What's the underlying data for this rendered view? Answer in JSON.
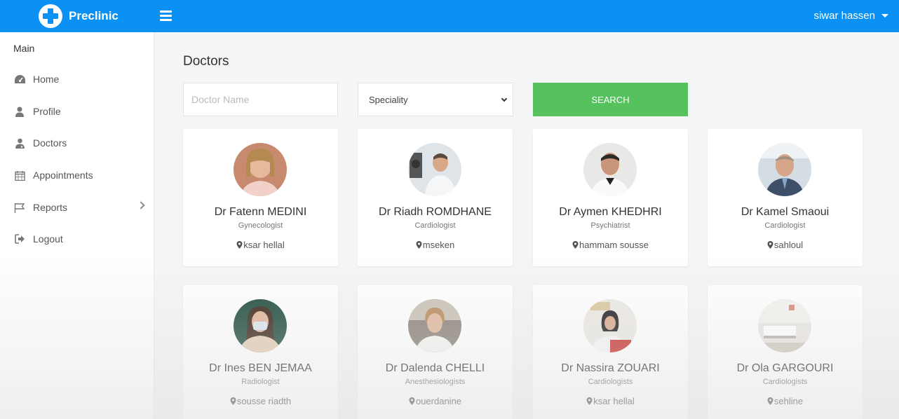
{
  "topbar": {
    "brand": "Preclinic",
    "user_name": "siwar hassen"
  },
  "sidebar": {
    "section_title": "Main",
    "items": [
      {
        "label": "Home",
        "icon": "dashboard-icon"
      },
      {
        "label": "Profile",
        "icon": "user-icon"
      },
      {
        "label": "Doctors",
        "icon": "doctor-icon"
      },
      {
        "label": "Appointments",
        "icon": "calendar-icon"
      },
      {
        "label": "Reports",
        "icon": "flag-icon"
      },
      {
        "label": "Logout",
        "icon": "logout-icon"
      }
    ]
  },
  "main": {
    "title": "Doctors",
    "search": {
      "placeholder": "Doctor Name",
      "value": "",
      "speciality_selected": "Speciality",
      "button_label": "SEARCH"
    },
    "doctors": [
      {
        "name": "Dr Fatenn MEDINI",
        "speciality": "Gynecologist",
        "location": "ksar hellal"
      },
      {
        "name": "Dr Riadh ROMDHANE",
        "speciality": "Cardiologist",
        "location": "mseken"
      },
      {
        "name": "Dr Aymen KHEDHRI",
        "speciality": "Psychiatrist",
        "location": "hammam sousse"
      },
      {
        "name": "Dr Kamel Smaoui",
        "speciality": "Cardiologist",
        "location": "sahloul"
      },
      {
        "name": "Dr Ines BEN JEMAA",
        "speciality": "Radiologist",
        "location": "sousse riadth"
      },
      {
        "name": "Dr Dalenda CHELLI",
        "speciality": "Anesthesiologists",
        "location": "ouerdanine"
      },
      {
        "name": "Dr Nassira ZOUARI",
        "speciality": "Cardiologists",
        "location": "ksar hellal"
      },
      {
        "name": "Dr Ola GARGOURI",
        "speciality": "Cardiologists",
        "location": "sehline"
      }
    ]
  },
  "colors": {
    "topbar": "#0a91f3",
    "search_button": "#55c25e"
  }
}
